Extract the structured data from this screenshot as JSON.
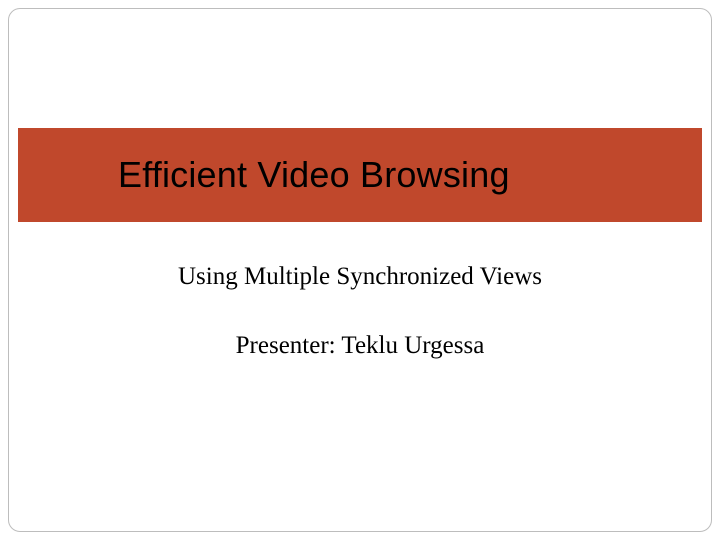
{
  "slide": {
    "title": "Efficient Video Browsing",
    "subtitle": "Using Multiple Synchronized Views",
    "presenter": "Presenter: Teklu Urgessa"
  }
}
